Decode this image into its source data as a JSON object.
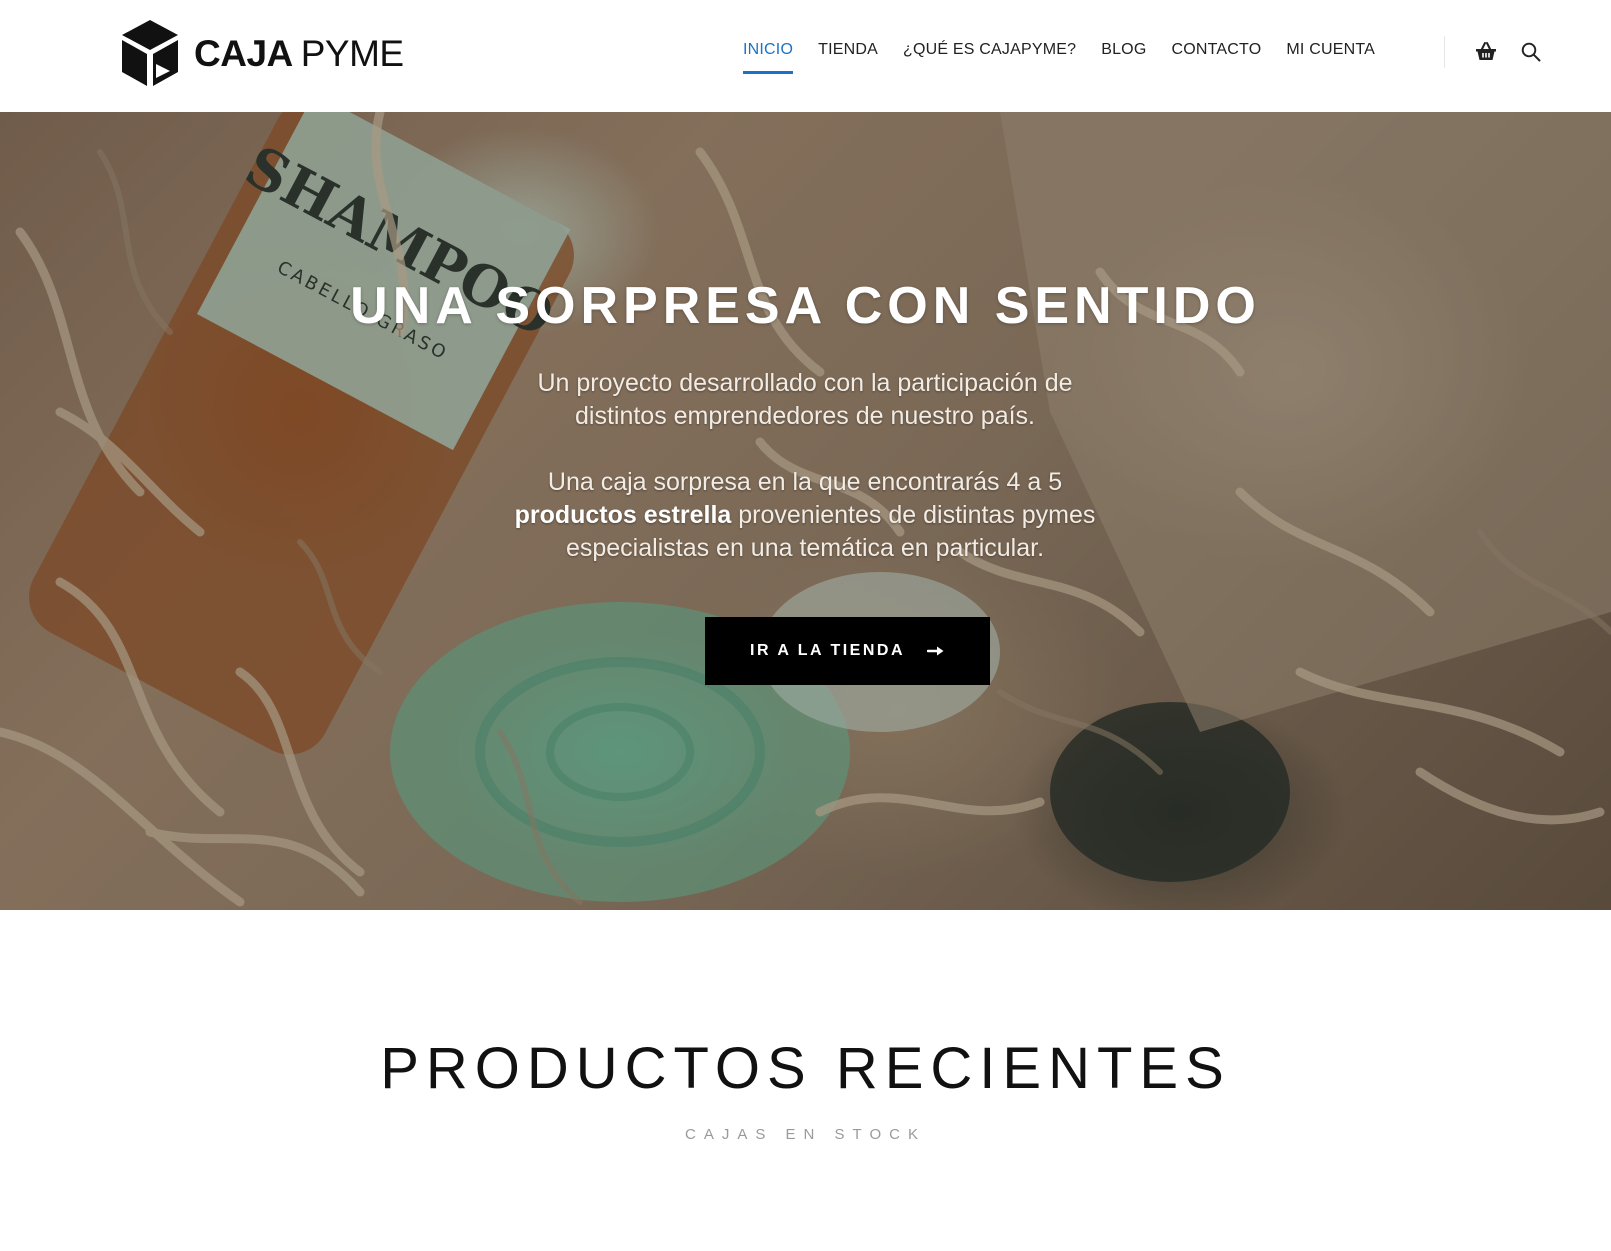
{
  "brand": {
    "name_strong": "CAJA",
    "name_light": "PYME"
  },
  "nav": {
    "items": [
      {
        "label": "INICIO",
        "active": true
      },
      {
        "label": "TIENDA",
        "active": false
      },
      {
        "label": "¿QUÉ ES CAJAPYME?",
        "active": false
      },
      {
        "label": "BLOG",
        "active": false
      },
      {
        "label": "CONTACTO",
        "active": false
      },
      {
        "label": "MI CUENTA",
        "active": false
      }
    ],
    "icons": [
      "basket-icon",
      "search-icon"
    ],
    "active_color": "#1a73c8"
  },
  "hero": {
    "title": "UNA SORPRESA CON SENTIDO",
    "paragraph1": "Un proyecto desarrollado con la participación de distintos emprendedores de nuestro país.",
    "paragraph2_start": "Una caja sorpresa en la que encontrarás 4 a 5 ",
    "paragraph2_bold": "productos estrella",
    "paragraph2_end": " provenientes de distintas pymes especialistas en una temática en particular.",
    "image_text": {
      "bottle_label": "SHAMPOO",
      "bottle_sub": "CABELLO GRASO"
    },
    "cta_label": "IR A LA TIENDA",
    "cta_icon": "arrow-right-icon"
  },
  "recent": {
    "title": "PRODUCTOS RECIENTES",
    "subtitle": "CAJAS EN STOCK"
  }
}
